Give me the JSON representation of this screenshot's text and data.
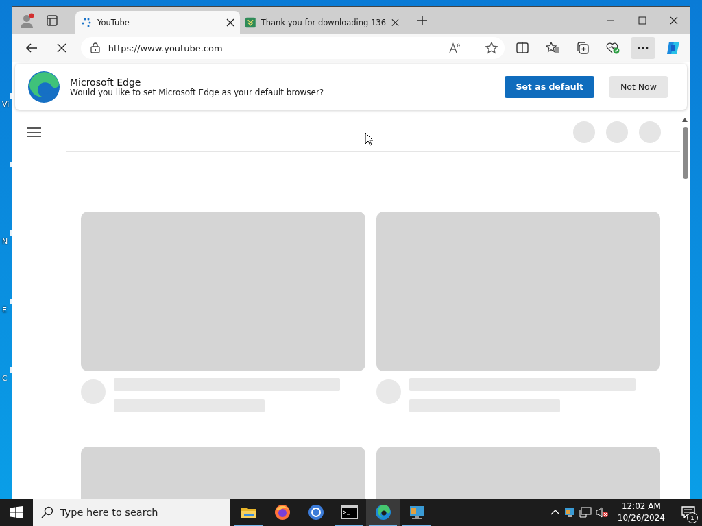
{
  "desktop": {
    "icons": [
      {
        "kind": "shortcut",
        "label": "Vi"
      },
      {
        "kind": "shortcut"
      },
      {
        "kind": "shortcut",
        "label": "N"
      },
      {
        "kind": "shortcut",
        "label": "E"
      },
      {
        "kind": "shortcut",
        "label": "C"
      }
    ]
  },
  "browser": {
    "tabs": [
      {
        "title": "YouTube",
        "kind": "loading",
        "selected": true
      },
      {
        "title": "Thank you for downloading 136",
        "kind": "download",
        "selected": false
      }
    ],
    "address": "https://www.youtube.com",
    "infobar": {
      "title": "Microsoft Edge",
      "message": "Would you like to set Microsoft Edge as your default browser?",
      "primary": "Set as default",
      "secondary": "Not Now"
    }
  },
  "taskbar": {
    "search_placeholder": "Type here to search",
    "apps": [
      {
        "kind": "folder",
        "running": true,
        "selected": false
      },
      {
        "kind": "firefox",
        "running": false,
        "selected": false
      },
      {
        "kind": "chromium",
        "running": false,
        "selected": false
      },
      {
        "kind": "terminal",
        "running": true,
        "selected": false
      },
      {
        "kind": "edge",
        "running": true,
        "selected": true
      },
      {
        "kind": "computer",
        "running": true,
        "selected": false
      }
    ],
    "time": "12:02 AM",
    "date": "10/26/2024",
    "notifications": "1"
  }
}
